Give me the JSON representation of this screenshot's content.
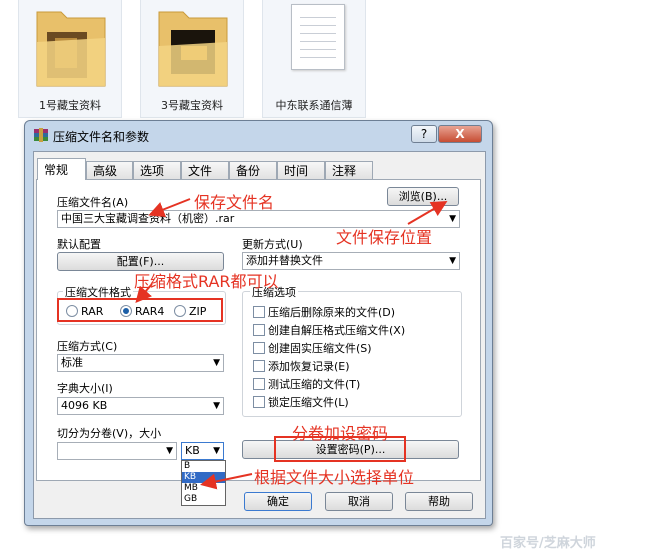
{
  "desktop": {
    "items": [
      {
        "label": "1号藏宝资料"
      },
      {
        "label": "3号藏宝资料"
      },
      {
        "label": "中东联系通信薄"
      }
    ]
  },
  "dialog": {
    "title": "压缩文件名和参数",
    "help_label": "?",
    "close_label": "X",
    "tabs": [
      "常规",
      "高级",
      "选项",
      "文件",
      "备份",
      "时间",
      "注释"
    ],
    "archive_name_label": "压缩文件名(A)",
    "archive_name_value": "中国三大宝藏调查资料（机密）.rar",
    "browse_label": "浏览(B)...",
    "default_profile_label": "默认配置",
    "profiles_button": "配置(F)...",
    "update_mode_label": "更新方式(U)",
    "update_mode_value": "添加并替换文件",
    "archive_format_label": "压缩文件格式",
    "formats": [
      {
        "label": "RAR",
        "selected": false
      },
      {
        "label": "RAR4",
        "selected": true
      },
      {
        "label": "ZIP",
        "selected": false
      }
    ],
    "archive_options_label": "压缩选项",
    "options": [
      "压缩后删除原来的文件(D)",
      "创建自解压格式压缩文件(X)",
      "创建固实压缩文件(S)",
      "添加恢复记录(E)",
      "测试压缩的文件(T)",
      "锁定压缩文件(L)"
    ],
    "compression_method_label": "压缩方式(C)",
    "compression_method_value": "标准",
    "dictionary_size_label": "字典大小(I)",
    "dictionary_size_value": "4096 KB",
    "split_label": "切分为分卷(V)，大小",
    "split_value": "",
    "split_unit_value": "KB",
    "unit_options": [
      "B",
      "KB",
      "MB",
      "GB"
    ],
    "unit_selected": "KB",
    "set_password_button": "设置密码(P)...",
    "ok_button": "确定",
    "cancel_button": "取消",
    "help_button": "帮助"
  },
  "annotations": {
    "save_filename": "保存文件名",
    "save_location": "文件保存位置",
    "format_note": "压缩格式RAR都可以",
    "password_note": "分卷加设密码",
    "unit_note": "根据文件大小选择单位",
    "color": "#e53323"
  },
  "watermark": "百家号/芝麻大师"
}
